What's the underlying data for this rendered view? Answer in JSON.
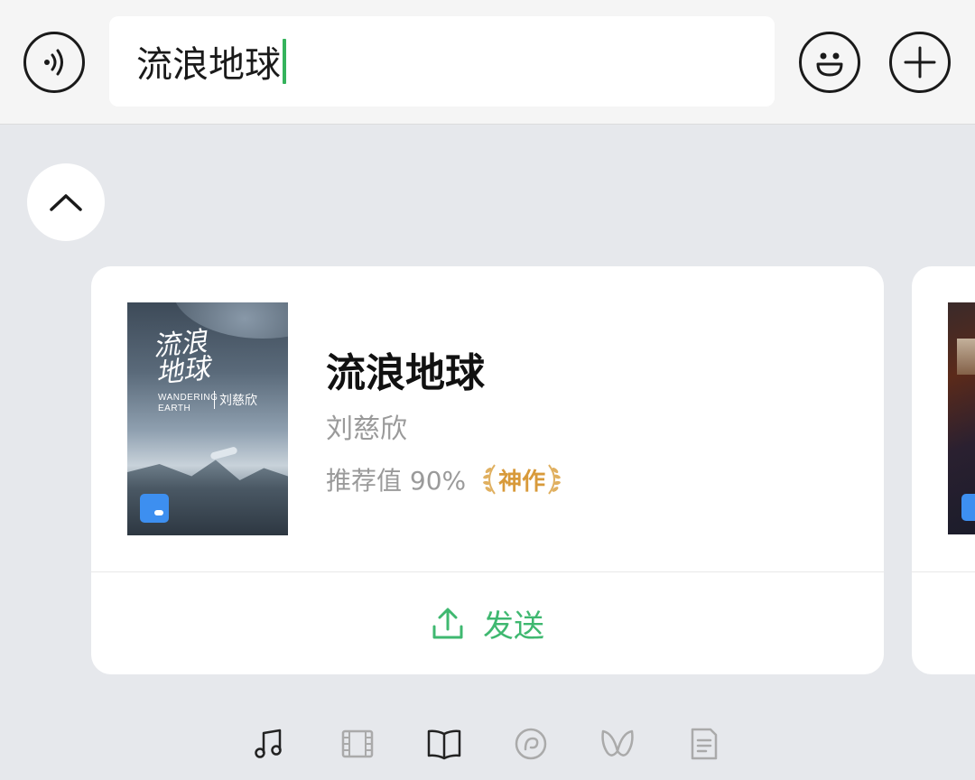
{
  "input": {
    "value": "流浪地球"
  },
  "icons": {
    "voice": "voice-icon",
    "emoji": "emoji-icon",
    "plus": "plus-icon",
    "collapse": "chevron-up-icon",
    "send": "upload-icon"
  },
  "card": {
    "cover": {
      "title_art": "流浪\n地球",
      "subtitle_art": "WANDERING\nEARTH",
      "author_art": "刘慈欣"
    },
    "title": "流浪地球",
    "author": "刘慈欣",
    "rating_label": "推荐值 90%",
    "rating_tag": "神作",
    "send_label": "发送"
  },
  "tabs": [
    {
      "icon": "music-icon",
      "active": false
    },
    {
      "icon": "film-icon",
      "active": false
    },
    {
      "icon": "book-icon",
      "active": true
    },
    {
      "icon": "podcast-icon",
      "active": false
    },
    {
      "icon": "butterfly-icon",
      "active": false
    },
    {
      "icon": "article-icon",
      "active": false
    }
  ],
  "colors": {
    "accent_green": "#3fb870",
    "caret_green": "#35b35c",
    "tag_gold": "#d89a3a",
    "badge_blue": "#3d8ff0"
  }
}
